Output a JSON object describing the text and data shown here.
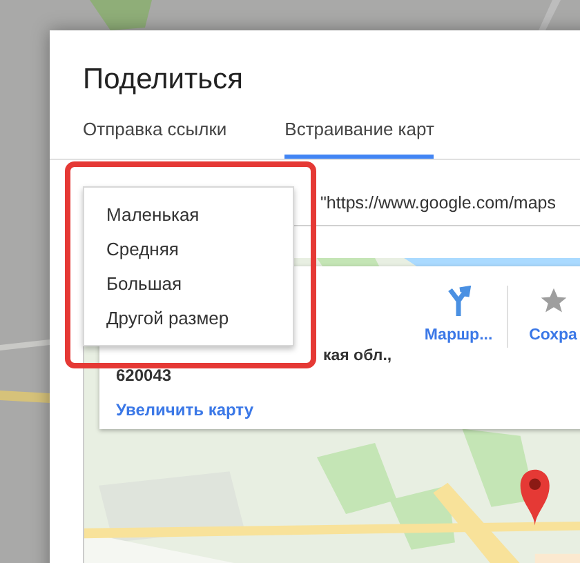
{
  "dialog": {
    "title": "Поделиться"
  },
  "tabs": [
    {
      "label": "Отправка ссылки",
      "selected": false
    },
    {
      "label": "Встраивание карт",
      "selected": true
    }
  ],
  "embed_code": {
    "value": "\"https://www.google.com/maps"
  },
  "size_menu": {
    "items": [
      "Маленькая",
      "Средняя",
      "Большая",
      "Другой размер"
    ]
  },
  "place_card": {
    "address_line_1": "кая обл.,",
    "address_line_2": "620043",
    "link": "Увеличить карту",
    "actions": [
      {
        "kind": "directions",
        "label": "Маршр..."
      },
      {
        "kind": "save",
        "label": "Сохра"
      }
    ]
  }
}
